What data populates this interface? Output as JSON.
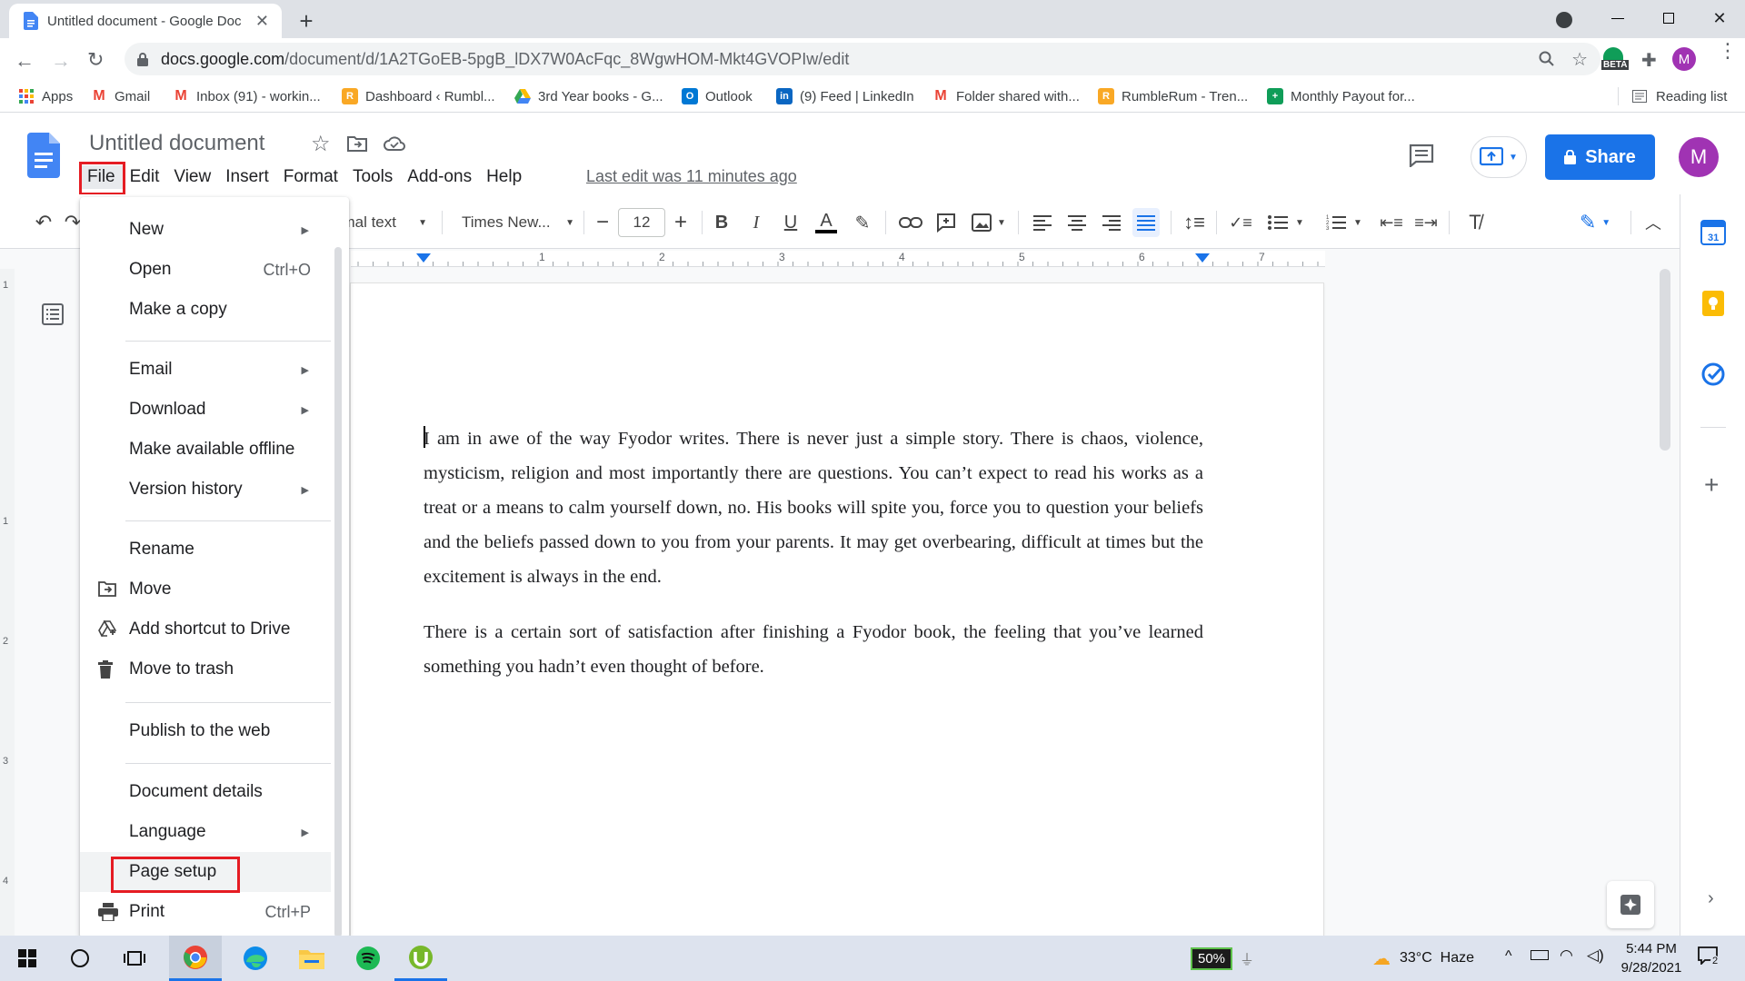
{
  "browser": {
    "tab_title": "Untitled document - Google Doc",
    "url_host": "docs.google.com",
    "url_path": "/document/d/1A2TGoEB-5pgB_lDX7W0AcFqc_8WgwHOM-Mkt4GVOPIw/edit",
    "extension_badge": "BETA",
    "profile_initial": "M"
  },
  "bookmarks": [
    {
      "label": "Apps",
      "color": "#ea4335"
    },
    {
      "label": "Gmail",
      "color": "#ea4335"
    },
    {
      "label": "Inbox (91) - workin...",
      "color": "#ea4335"
    },
    {
      "label": "Dashboard ‹ Rumbl...",
      "color": "#f9a825"
    },
    {
      "label": "3rd Year books - G...",
      "color": "#34a853"
    },
    {
      "label": "Outlook",
      "color": "#0078d4"
    },
    {
      "label": "(9) Feed | LinkedIn",
      "color": "#0a66c2"
    },
    {
      "label": "Folder shared with...",
      "color": "#ea4335"
    },
    {
      "label": "RumbleRum - Tren...",
      "color": "#f9a825"
    },
    {
      "label": "Monthly Payout for...",
      "color": "#0f9d58"
    }
  ],
  "reading_list": "Reading list",
  "docs": {
    "title": "Untitled document",
    "menus": [
      "File",
      "Edit",
      "View",
      "Insert",
      "Format",
      "Tools",
      "Add-ons",
      "Help"
    ],
    "last_edit": "Last edit was 11 minutes ago",
    "share_label": "Share",
    "avatar_initial": "M",
    "accent_color": "#1a73e8"
  },
  "toolbar": {
    "style_value": "Normal text",
    "font_value": "Times New...",
    "font_size": "12"
  },
  "ruler_numbers": [
    "1",
    "2",
    "3",
    "4",
    "5",
    "6",
    "7"
  ],
  "vruler_numbers": [
    "1",
    "1",
    "2",
    "3",
    "4"
  ],
  "file_menu": {
    "items": [
      {
        "label": "New",
        "submenu": true
      },
      {
        "label": "Open",
        "shortcut": "Ctrl+O"
      },
      {
        "label": "Make a copy"
      },
      {
        "label": "Email",
        "submenu": true
      },
      {
        "label": "Download",
        "submenu": true
      },
      {
        "label": "Make available offline"
      },
      {
        "label": "Version history",
        "submenu": true
      },
      {
        "label": "Rename"
      },
      {
        "label": "Move",
        "icon": "move-icon"
      },
      {
        "label": "Add shortcut to Drive",
        "icon": "drive-shortcut-icon"
      },
      {
        "label": "Move to trash",
        "icon": "trash-icon"
      },
      {
        "label": "Publish to the web"
      },
      {
        "label": "Document details"
      },
      {
        "label": "Language",
        "submenu": true
      },
      {
        "label": "Page setup",
        "highlighted": true
      },
      {
        "label": "Print",
        "shortcut": "Ctrl+P",
        "icon": "print-icon"
      }
    ]
  },
  "document": {
    "paragraphs": [
      "I am in awe of the way Fyodor writes. There is never just a simple story. There is chaos, violence, mysticism, religion and most importantly there are questions. You can’t expect to read his works as a treat or a means to calm yourself down, no. His books will spite you, force you to question your beliefs and the beliefs passed down to you from your parents. It may get overbearing, difficult at times but the excitement is always in the end.",
      "There is a certain sort of satisfaction after finishing a Fyodor book, the feeling that you’ve learned something you hadn’t even thought of before."
    ]
  },
  "taskbar": {
    "battery": "50%",
    "weather": "33°C  Haze",
    "time": "5:44 PM",
    "date": "9/28/2021",
    "notifications": "2"
  }
}
